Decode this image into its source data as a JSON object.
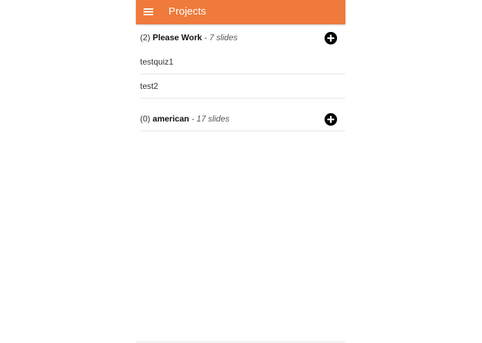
{
  "app_bar": {
    "title": "Projects",
    "background": "#ef7a3b",
    "menu_icon": "hamburger-menu-icon"
  },
  "projects": [
    {
      "count": "(2)",
      "name": "Please Work",
      "slides": "- 7 slides",
      "add_icon": "plus-circle-icon",
      "items": [
        "testquiz1",
        "test2"
      ]
    },
    {
      "count": "(0)",
      "name": "american",
      "slides": "- 17 slides",
      "add_icon": "plus-circle-icon",
      "items": []
    }
  ]
}
